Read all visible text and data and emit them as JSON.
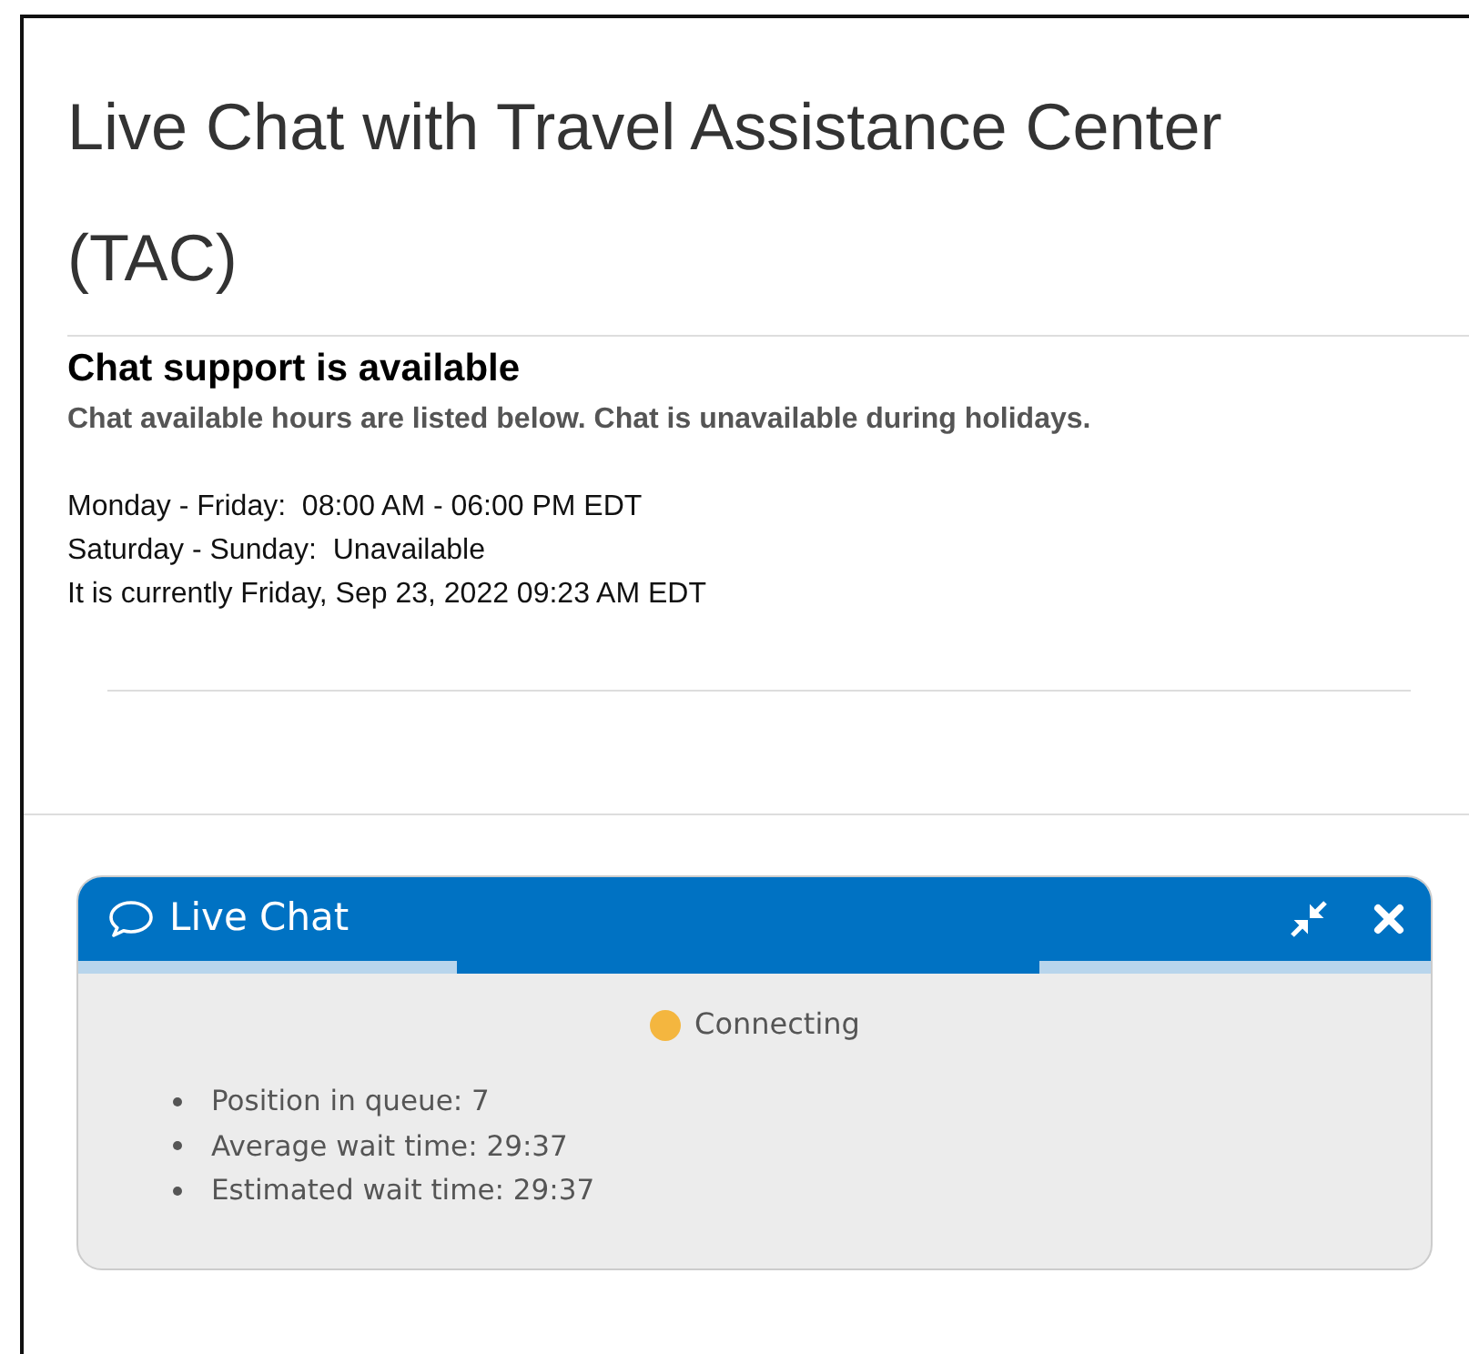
{
  "page": {
    "title": "Live Chat with Travel Assistance Center (TAC)"
  },
  "availability": {
    "heading": "Chat support is available",
    "note": "Chat available hours are listed below. Chat is unavailable during holidays.",
    "hours": [
      "Monday - Friday:  08:00 AM - 06:00 PM EDT",
      "Saturday - Sunday:  Unavailable",
      "It is currently Friday, Sep 23, 2022 09:23 AM EDT"
    ]
  },
  "chat_widget": {
    "title": "Live Chat",
    "status": {
      "label": "Connecting",
      "color": "#f4b63f"
    },
    "queue_info": [
      "Position in queue: 7",
      "Average wait time: 29:37",
      "Estimated wait time: 29:37"
    ]
  }
}
